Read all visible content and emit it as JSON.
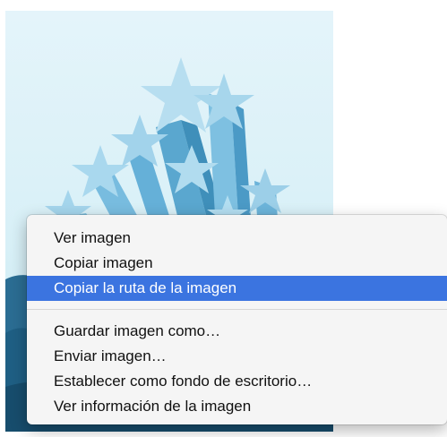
{
  "background_image": {
    "icon": "stars-illustration",
    "colors": {
      "sky": "#d8f0f7",
      "star_fill": "#9fd1ea",
      "star_side": "#5aa7cf",
      "wave": "#1f5f84"
    }
  },
  "context_menu": {
    "items": [
      {
        "label": "Ver imagen"
      },
      {
        "label": "Copiar imagen"
      },
      {
        "label": "Copiar la ruta de la imagen",
        "selected": true
      },
      {
        "label": "Guardar imagen como…"
      },
      {
        "label": "Enviar imagen…"
      },
      {
        "label": "Establecer como fondo de escritorio…"
      },
      {
        "label": "Ver información de la imagen"
      }
    ],
    "selected_color": "#3b74e0"
  }
}
